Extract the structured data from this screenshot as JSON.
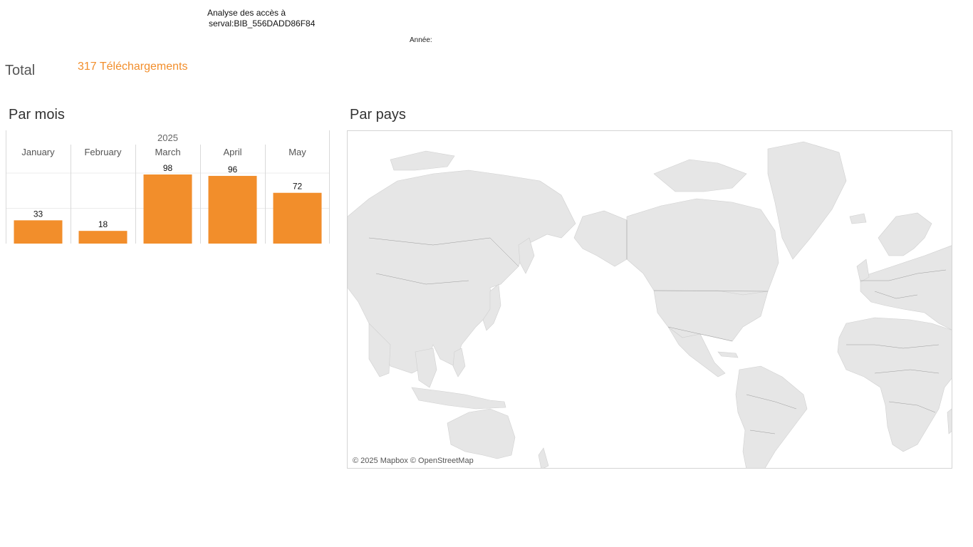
{
  "header": {
    "title_line1": "Analyse des accès à",
    "title_line2": "serval:BIB_556DADD86F84",
    "year_filter_label": "Année:"
  },
  "total": {
    "label": "Total",
    "value": "317 Téléchargements"
  },
  "sections": {
    "by_month": "Par mois",
    "by_country": "Par pays"
  },
  "colors": {
    "bar": "#f28e2b",
    "land": "#e6e6e6",
    "borders": "#9a9a9a"
  },
  "chart_data": {
    "type": "bar",
    "year": "2025",
    "categories": [
      "January",
      "February",
      "March",
      "April",
      "May"
    ],
    "values": [
      33,
      18,
      98,
      96,
      72
    ],
    "ylim": [
      0,
      100
    ],
    "grid": true,
    "data_labels": true
  },
  "map": {
    "attribution": "© 2025 Mapbox © OpenStreetMap"
  }
}
